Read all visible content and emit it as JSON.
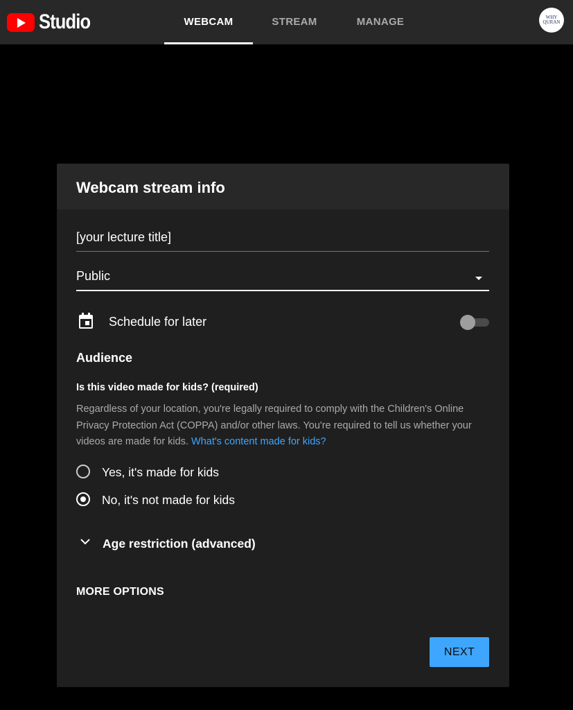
{
  "app": {
    "logo_text": "Studio"
  },
  "tabs": [
    {
      "label": "WEBCAM",
      "active": true
    },
    {
      "label": "STREAM",
      "active": false
    },
    {
      "label": "MANAGE",
      "active": false
    }
  ],
  "avatar": {
    "line1": "WHY",
    "line2": "QURAN"
  },
  "card": {
    "title": "Webcam stream info",
    "title_field_value": "[your lecture title]",
    "visibility_value": "Public",
    "schedule_label": "Schedule for later",
    "schedule_enabled": false,
    "audience_heading": "Audience",
    "kids_question": "Is this video made for kids? (required)",
    "kids_description": "Regardless of your location, you're legally required to comply with the Children's Online Privacy Protection Act (COPPA) and/or other laws. You're required to tell us whether your videos are made for kids.",
    "kids_link": "What's content made for kids?",
    "radio_yes": "Yes, it's made for kids",
    "radio_no": "No, it's not made for kids",
    "selected": "no",
    "age_restriction": "Age restriction (advanced)",
    "more_options": "MORE OPTIONS",
    "next_label": "NEXT"
  },
  "colors": {
    "accent": "#3ea6ff",
    "brand": "#ff0000",
    "bar": "#282828",
    "card": "#1f1f1f"
  },
  "icons": [
    "youtube-logo-icon",
    "calendar-icon",
    "dropdown-arrow-icon",
    "chevron-down-icon"
  ]
}
